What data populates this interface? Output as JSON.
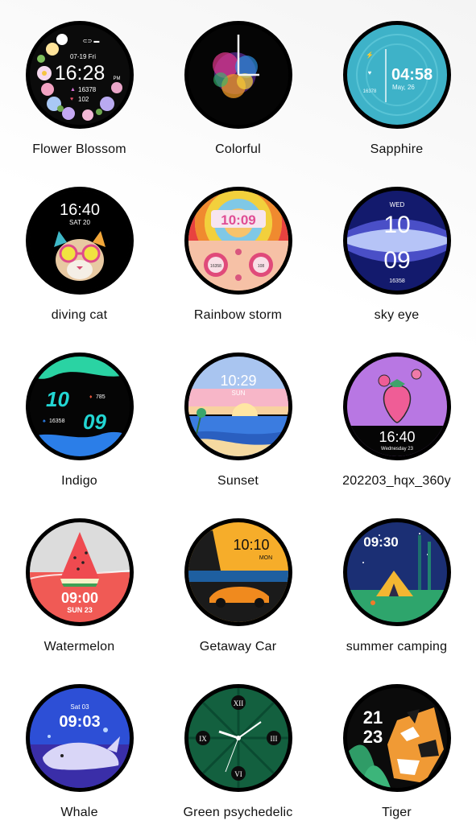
{
  "watch_faces": [
    {
      "name": "Flower Blossom",
      "icon": "flower-blossom-face",
      "texts": {
        "date": "07-19 Fri",
        "time": "16:28",
        "ampm": "PM",
        "steps": "16378",
        "heart": "102"
      }
    },
    {
      "name": "Colorful",
      "icon": "colorful-explosion-face",
      "texts": {}
    },
    {
      "name": "Sapphire",
      "icon": "sapphire-face",
      "texts": {
        "time": "04:58",
        "date": "May, 26",
        "steps": "16378"
      }
    },
    {
      "name": "diving cat",
      "icon": "diving-cat-face",
      "texts": {
        "time": "16:40",
        "date": "SAT 20"
      }
    },
    {
      "name": "Rainbow storm",
      "icon": "rainbow-storm-face",
      "texts": {
        "time": "10:09",
        "left_value": "16358",
        "right_value": "108"
      }
    },
    {
      "name": "sky eye",
      "icon": "sky-eye-face",
      "texts": {
        "day": "WED",
        "hour": "10",
        "minute": "09",
        "steps": "16358"
      }
    },
    {
      "name": "Indigo",
      "icon": "indigo-face",
      "texts": {
        "hour": "10",
        "minute": "09",
        "heart": "785",
        "steps": "16358"
      }
    },
    {
      "name": "Sunset",
      "icon": "sunset-face",
      "texts": {
        "time": "10:29",
        "day": "SUN"
      }
    },
    {
      "name": "202203_hqx_360y",
      "icon": "strawberry-face",
      "texts": {
        "time": "16:40",
        "date": "Wednesday 23"
      }
    },
    {
      "name": "Watermelon",
      "icon": "watermelon-face",
      "texts": {
        "time": "09:00",
        "date": "SUN 23"
      }
    },
    {
      "name": "Getaway Car",
      "icon": "getaway-car-face",
      "texts": {
        "time": "10:10",
        "day": "MON"
      }
    },
    {
      "name": "summer camping",
      "icon": "summer-camping-face",
      "texts": {
        "time": "09:30"
      }
    },
    {
      "name": "Whale",
      "icon": "whale-face",
      "texts": {
        "date": "Sat 03",
        "time": "09:03"
      }
    },
    {
      "name": "Green psychedelic",
      "icon": "green-psychedelic-face",
      "texts": {
        "numerals": [
          "XII",
          "III",
          "VI",
          "IX"
        ]
      }
    },
    {
      "name": "Tiger",
      "icon": "tiger-face",
      "texts": {
        "hour": "21",
        "minute": "23"
      }
    }
  ]
}
